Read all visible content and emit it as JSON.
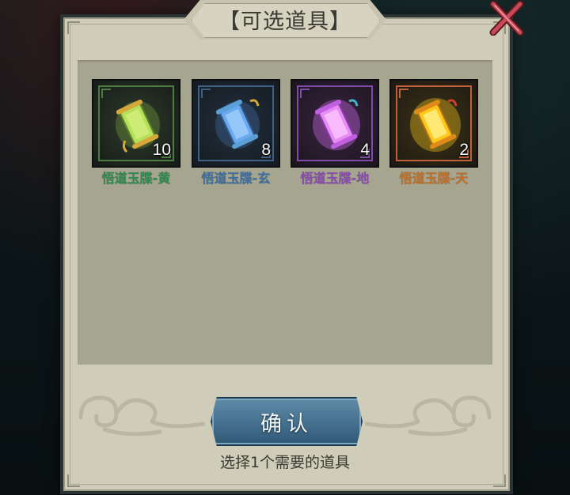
{
  "dialog": {
    "title": "【可选道具】",
    "confirm_label": "确认",
    "hint": "选择1个需要的道具"
  },
  "items": [
    {
      "name": "悟道玉牒-黄",
      "count": "10",
      "name_color": "#2f8a4f",
      "border_color": "#4f7a43",
      "glow": "#9fd04a",
      "icon": "scroll-icon"
    },
    {
      "name": "悟道玉牒-玄",
      "count": "8",
      "name_color": "#3f6fa0",
      "border_color": "#3f5f83",
      "glow": "#5fa0ff",
      "icon": "scroll-icon"
    },
    {
      "name": "悟道玉牒-地",
      "count": "4",
      "name_color": "#8a4cae",
      "border_color": "#7e4ba7",
      "glow": "#e070ff",
      "icon": "scroll-icon"
    },
    {
      "name": "悟道玉牒-天",
      "count": "2",
      "name_color": "#c0702a",
      "border_color": "#c0603a",
      "glow": "#ffd21a",
      "icon": "scroll-icon"
    }
  ]
}
